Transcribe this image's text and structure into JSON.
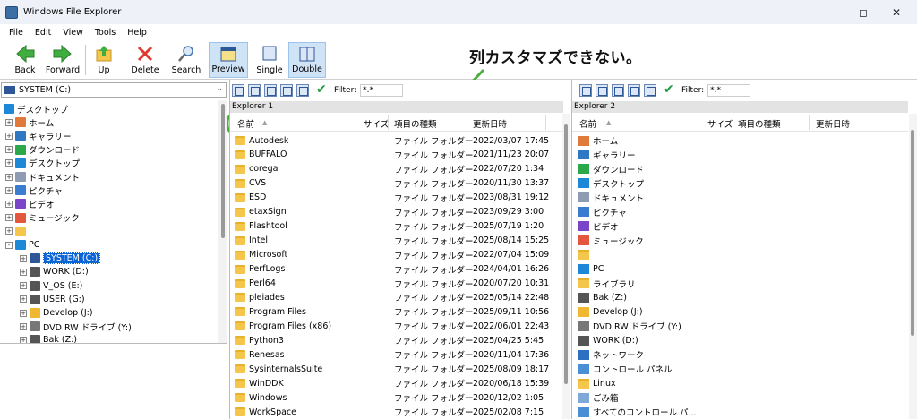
{
  "window": {
    "title": "Windows File Explorer"
  },
  "menu": [
    "File",
    "Edit",
    "View",
    "Tools",
    "Help"
  ],
  "toolbar": {
    "back": "Back",
    "forward": "Forward",
    "up": "Up",
    "delete": "Delete",
    "search": "Search",
    "preview": "Preview",
    "single": "Single",
    "double": "Double"
  },
  "annotation": "列カスタマズできない。",
  "drive_selector": "SYSTEM (C:)",
  "tree": [
    {
      "label": "デスクトップ",
      "icon": "desktop-icon",
      "indent": 0,
      "exp": ""
    },
    {
      "label": "ホーム",
      "icon": "home-icon",
      "indent": 1,
      "exp": "+"
    },
    {
      "label": "ギャラリー",
      "icon": "gallery-icon",
      "indent": 1,
      "exp": "+"
    },
    {
      "label": "ダウンロード",
      "icon": "download-icon",
      "indent": 1,
      "exp": "+"
    },
    {
      "label": "デスクトップ",
      "icon": "desktop-icon",
      "indent": 1,
      "exp": "+"
    },
    {
      "label": "ドキュメント",
      "icon": "document-icon",
      "indent": 1,
      "exp": "+"
    },
    {
      "label": "ピクチャ",
      "icon": "pictures-icon",
      "indent": 1,
      "exp": "+"
    },
    {
      "label": "ビデオ",
      "icon": "video-icon",
      "indent": 1,
      "exp": "+"
    },
    {
      "label": "ミュージック",
      "icon": "music-icon",
      "indent": 1,
      "exp": "+"
    },
    {
      "label": "",
      "icon": "folder-icon",
      "indent": 1,
      "exp": "+"
    },
    {
      "label": "PC",
      "icon": "pc-icon",
      "indent": 1,
      "exp": "-"
    },
    {
      "label": "SYSTEM (C:)",
      "icon": "system-drive-icon",
      "indent": 2,
      "exp": "+",
      "selected": true
    },
    {
      "label": "WORK (D:)",
      "icon": "drive-icon",
      "indent": 2,
      "exp": "+"
    },
    {
      "label": "V_OS (E:)",
      "icon": "drive-icon",
      "indent": 2,
      "exp": "+"
    },
    {
      "label": "USER (G:)",
      "icon": "drive-icon",
      "indent": 2,
      "exp": "+"
    },
    {
      "label": "Develop (J:)",
      "icon": "network-drive-icon",
      "indent": 2,
      "exp": "+"
    },
    {
      "label": "DVD RW ドライブ (Y:)",
      "icon": "dvd-drive-icon",
      "indent": 2,
      "exp": "+"
    },
    {
      "label": "Bak (Z:)",
      "icon": "drive-icon",
      "indent": 2,
      "exp": "+"
    }
  ],
  "explorer1": {
    "label": "Explorer 1",
    "filter_label": "Filter:",
    "filter_value": "*.*",
    "columns": {
      "name": "名前",
      "size": "サイズ",
      "type": "項目の種類",
      "date": "更新日時"
    },
    "rows": [
      {
        "name": "Autodesk",
        "type": "ファイル フォルダー",
        "date": "2022/03/07 17:45"
      },
      {
        "name": "BUFFALO",
        "type": "ファイル フォルダー",
        "date": "2021/11/23 20:07"
      },
      {
        "name": "corega",
        "type": "ファイル フォルダー",
        "date": "2022/07/20 1:34"
      },
      {
        "name": "CVS",
        "type": "ファイル フォルダー",
        "date": "2020/11/30 13:37"
      },
      {
        "name": "ESD",
        "type": "ファイル フォルダー",
        "date": "2023/08/31 19:12"
      },
      {
        "name": "etaxSign",
        "type": "ファイル フォルダー",
        "date": "2023/09/29 3:00"
      },
      {
        "name": "Flashtool",
        "type": "ファイル フォルダー",
        "date": "2025/07/19 1:20"
      },
      {
        "name": "Intel",
        "type": "ファイル フォルダー",
        "date": "2025/08/14 15:25"
      },
      {
        "name": "Microsoft",
        "type": "ファイル フォルダー",
        "date": "2022/07/04 15:09"
      },
      {
        "name": "PerfLogs",
        "type": "ファイル フォルダー",
        "date": "2024/04/01 16:26"
      },
      {
        "name": "Perl64",
        "type": "ファイル フォルダー",
        "date": "2020/07/20 10:31"
      },
      {
        "name": "pleiades",
        "type": "ファイル フォルダー",
        "date": "2025/05/14 22:48"
      },
      {
        "name": "Program Files",
        "type": "ファイル フォルダー",
        "date": "2025/09/11 10:56"
      },
      {
        "name": "Program Files (x86)",
        "type": "ファイル フォルダー",
        "date": "2022/06/01 22:43"
      },
      {
        "name": "Python3",
        "type": "ファイル フォルダー",
        "date": "2025/04/25 5:45"
      },
      {
        "name": "Renesas",
        "type": "ファイル フォルダー",
        "date": "2020/11/04 17:36"
      },
      {
        "name": "SysinternalsSuite",
        "type": "ファイル フォルダー",
        "date": "2025/08/09 18:17"
      },
      {
        "name": "WinDDK",
        "type": "ファイル フォルダー",
        "date": "2020/06/18 15:39"
      },
      {
        "name": "Windows",
        "type": "ファイル フォルダー",
        "date": "2020/12/02 1:05"
      },
      {
        "name": "WorkSpace",
        "type": "ファイル フォルダー",
        "date": "2025/02/08 7:15"
      }
    ]
  },
  "explorer2": {
    "label": "Explorer 2",
    "filter_label": "Filter:",
    "filter_value": "*.*",
    "columns": {
      "name": "名前",
      "size": "サイズ",
      "type": "項目の種類",
      "date": "更新日時"
    },
    "rows": [
      {
        "name": "ホーム",
        "icon": "home-icon"
      },
      {
        "name": "ギャラリー",
        "icon": "gallery-icon"
      },
      {
        "name": "ダウンロード",
        "icon": "download-icon"
      },
      {
        "name": "デスクトップ",
        "icon": "desktop-icon"
      },
      {
        "name": "ドキュメント",
        "icon": "document-icon"
      },
      {
        "name": "ピクチャ",
        "icon": "pictures-icon"
      },
      {
        "name": "ビデオ",
        "icon": "video-icon"
      },
      {
        "name": "ミュージック",
        "icon": "music-icon"
      },
      {
        "name": "",
        "icon": "folder-icon"
      },
      {
        "name": "PC",
        "icon": "pc-icon"
      },
      {
        "name": "ライブラリ",
        "icon": "folder-icon"
      },
      {
        "name": "Bak (Z:)",
        "icon": "drive-icon"
      },
      {
        "name": "Develop (J:)",
        "icon": "network-drive-icon"
      },
      {
        "name": "DVD RW ドライブ (Y:)",
        "icon": "dvd-drive-icon"
      },
      {
        "name": "WORK (D:)",
        "icon": "drive-icon"
      },
      {
        "name": "ネットワーク",
        "icon": "network-icon"
      },
      {
        "name": "コントロール パネル",
        "icon": "control-panel-icon"
      },
      {
        "name": "Linux",
        "icon": "folder-icon"
      },
      {
        "name": "ごみ箱",
        "icon": "recycle-bin-icon"
      },
      {
        "name": "すべてのコントロール パ...",
        "icon": "control-panel-icon"
      }
    ]
  },
  "colors": {
    "accent": "#0a64d8",
    "annotation_green": "#4cae3c",
    "folder": "#f4c64b"
  }
}
